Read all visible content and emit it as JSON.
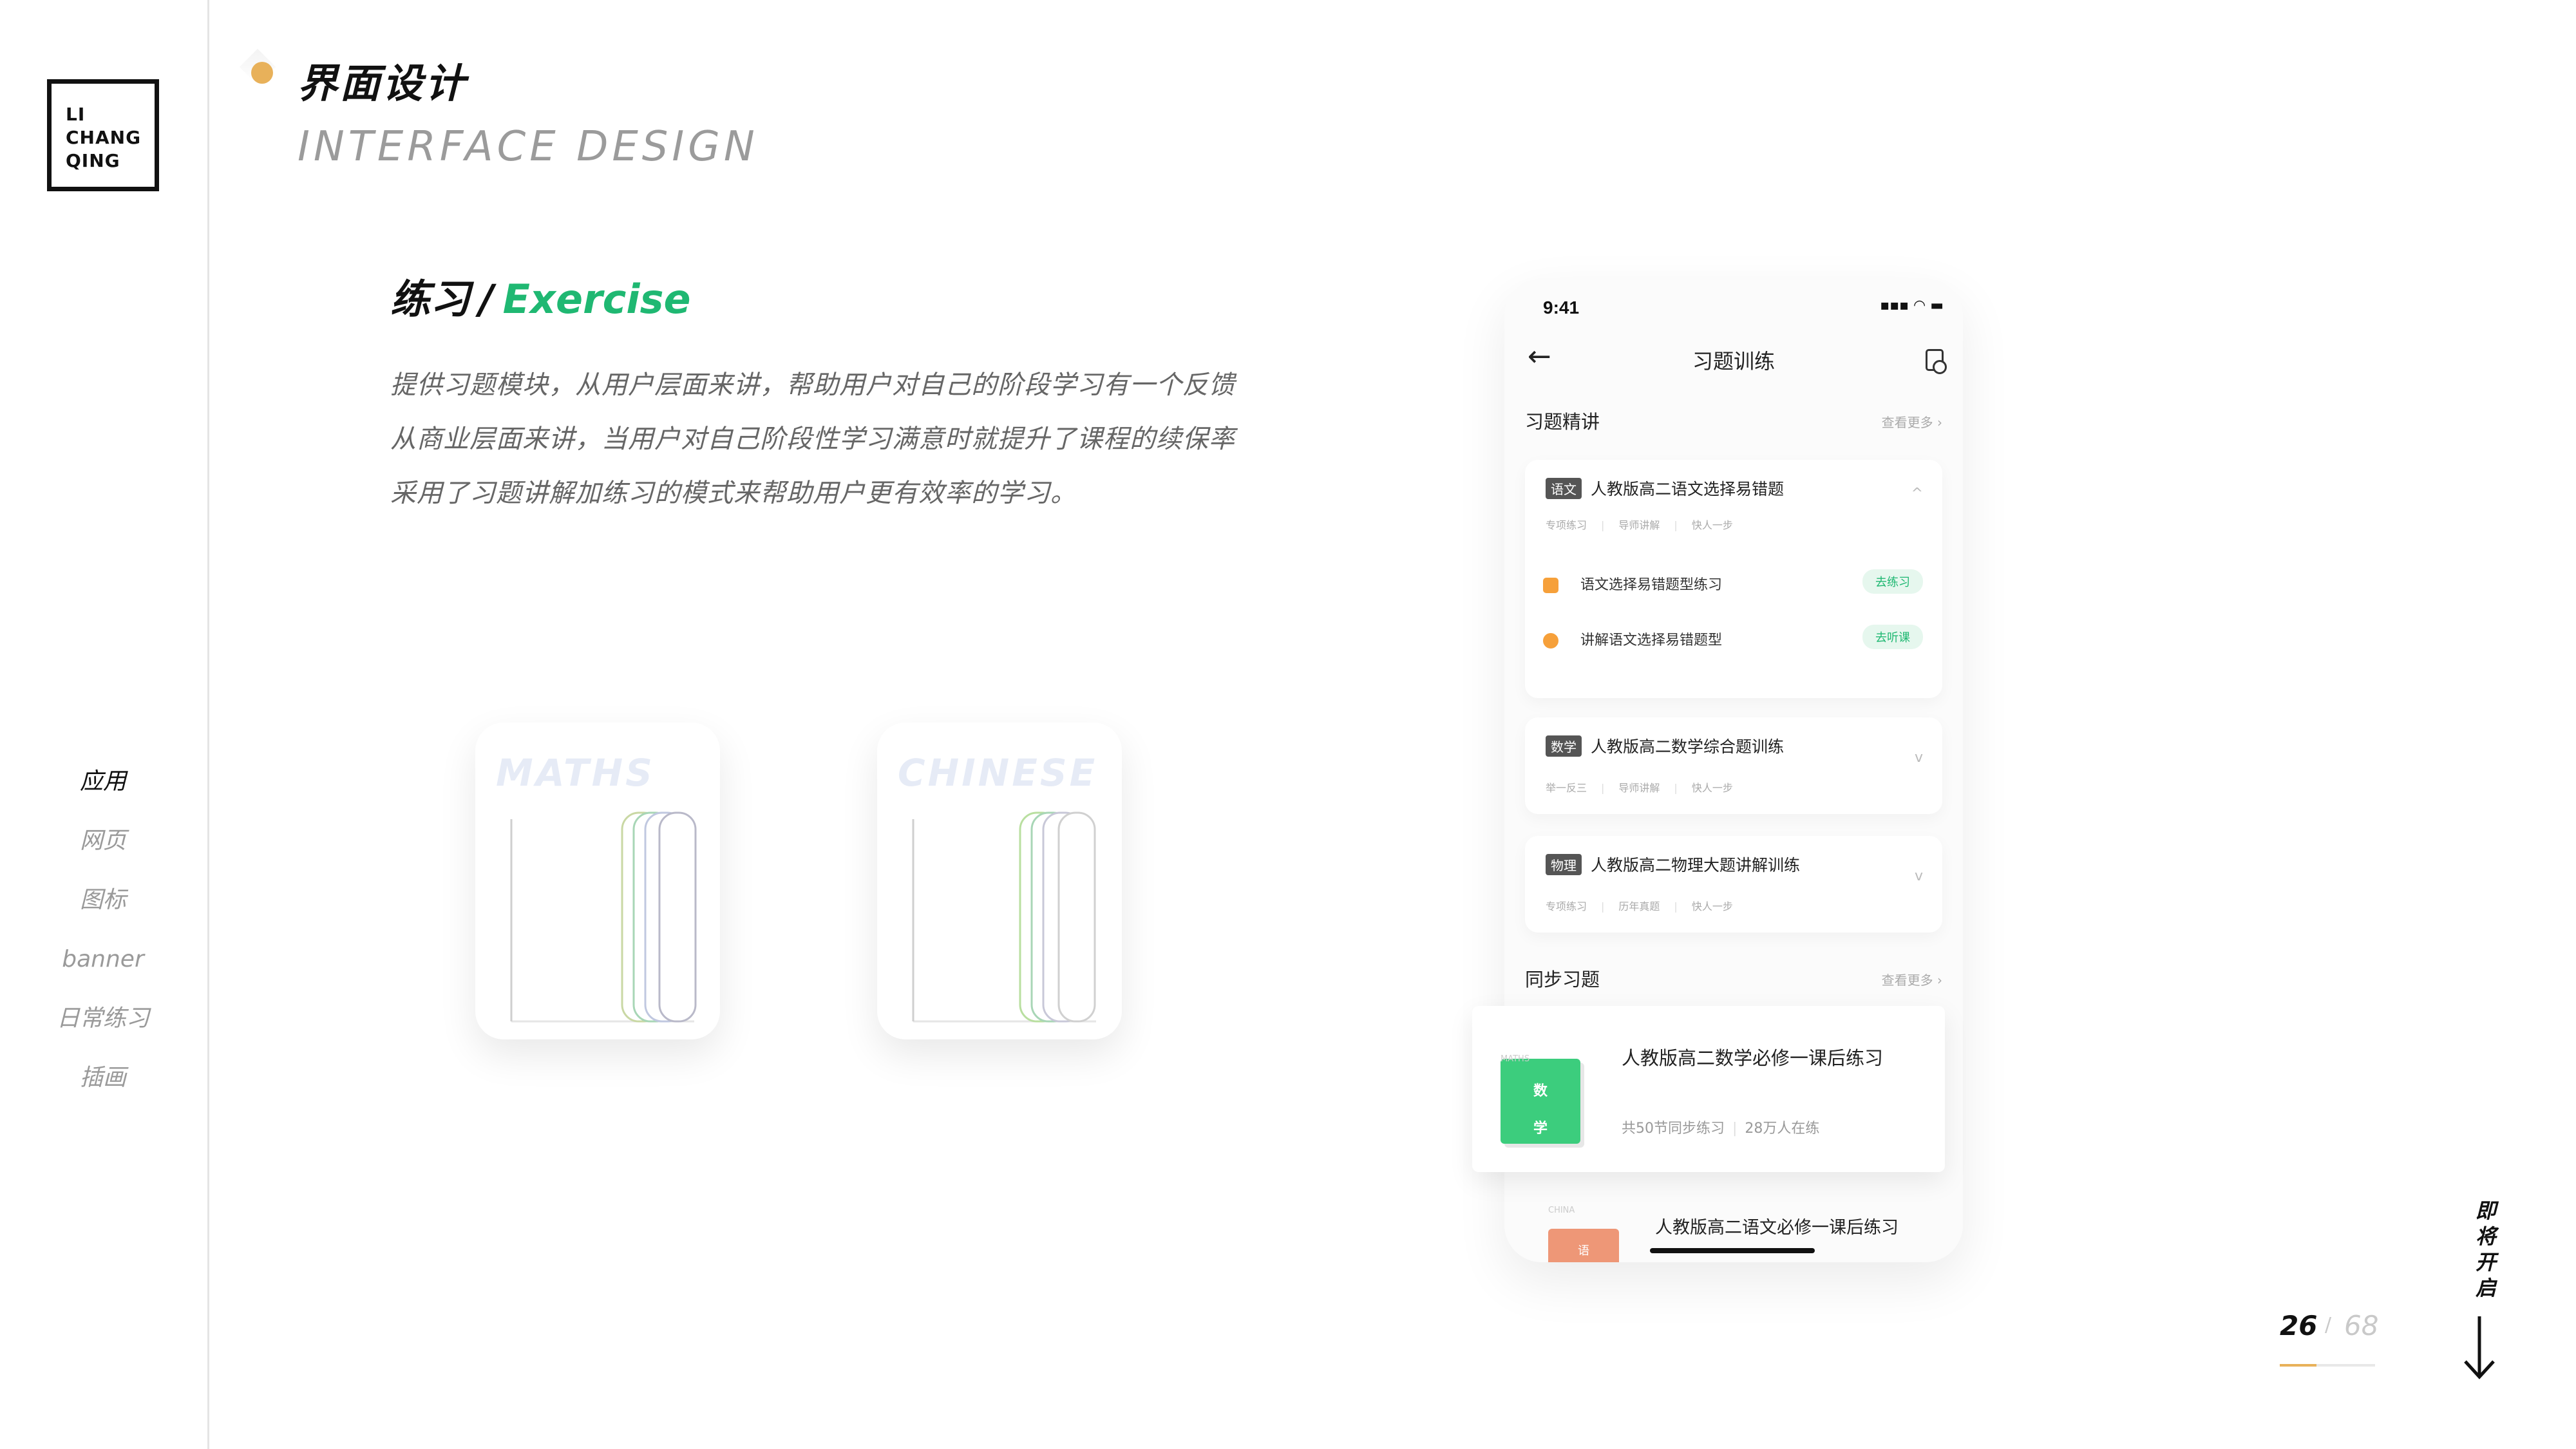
{
  "brand": {
    "lines": [
      "LI",
      "CHANG",
      "QING"
    ]
  },
  "header": {
    "title": "界面设计",
    "subtitle": "INTERFACE DESIGN"
  },
  "nav": [
    {
      "label": "应用",
      "active": true
    },
    {
      "label": "网页",
      "active": false
    },
    {
      "label": "图标",
      "active": false
    },
    {
      "label": "banner",
      "active": false
    },
    {
      "label": "日常练习",
      "active": false
    },
    {
      "label": "插画",
      "active": false
    }
  ],
  "section": {
    "title_cn": "练习",
    "separator": "/",
    "title_en": "Exercise",
    "description": [
      "提供习题模块，从用户层面来讲，帮助用户对自己的阶段学习有一个反馈",
      "从商业层面来讲，当用户对自己阶段性学习满意时就提升了课程的续保率",
      "采用了习题讲解加练习的模式来帮助用户更有效率的学习。"
    ]
  },
  "books": [
    {
      "label": "MATHS"
    },
    {
      "label": "CHINESE"
    }
  ],
  "phone": {
    "status_time": "9:41",
    "status_icons": "▪▪▪ ◠ ▬",
    "back_icon": "←",
    "nav_title": "习题训练",
    "section1": {
      "title": "习题精讲",
      "more": "查看更多 ›"
    },
    "cards": [
      {
        "subject": "语文",
        "title": "人教版高二语文选择易错题",
        "meta": [
          "专项练习",
          "|",
          "导师讲解",
          "|",
          "快人一步"
        ],
        "chevron": "^",
        "items": [
          {
            "label": "语文选择易错题型练习",
            "button": "去练习"
          },
          {
            "label": "讲解语文选择易错题型",
            "button": "去听课"
          }
        ]
      },
      {
        "subject": "数学",
        "title": "人教版高二数学综合题训练",
        "meta": [
          "举一反三",
          "|",
          "导师讲解",
          "|",
          "快人一步"
        ],
        "chevron": "v"
      },
      {
        "subject": "物理",
        "title": "人教版高二物理大题讲解训练",
        "meta": [
          "专项练习",
          "|",
          "历年真题",
          "|",
          "快人一步"
        ],
        "chevron": "v"
      }
    ],
    "section2": {
      "title": "同步习题",
      "more": "查看更多 ›"
    },
    "courses": [
      {
        "cover_tag": "MATHS",
        "cover_line1": "数",
        "cover_line2": "学",
        "title": "人教版高二数学必修一课后练习",
        "lessons": "共50节同步练习",
        "online": "28万人在练"
      },
      {
        "cover_tag": "CHINA",
        "cover_line1": "语",
        "title": "人教版高二语文必修一课后练习"
      }
    ]
  },
  "pagination": {
    "current": "26",
    "separator": "/",
    "total": "68",
    "progress": 0.382
  },
  "scroll_hint": [
    "即",
    "将",
    "开",
    "启"
  ],
  "colors": {
    "accent_green": "#1fb872",
    "accent_gold": "#e8b15a",
    "text_dark": "#111111",
    "text_gray": "#9a9a9a"
  }
}
